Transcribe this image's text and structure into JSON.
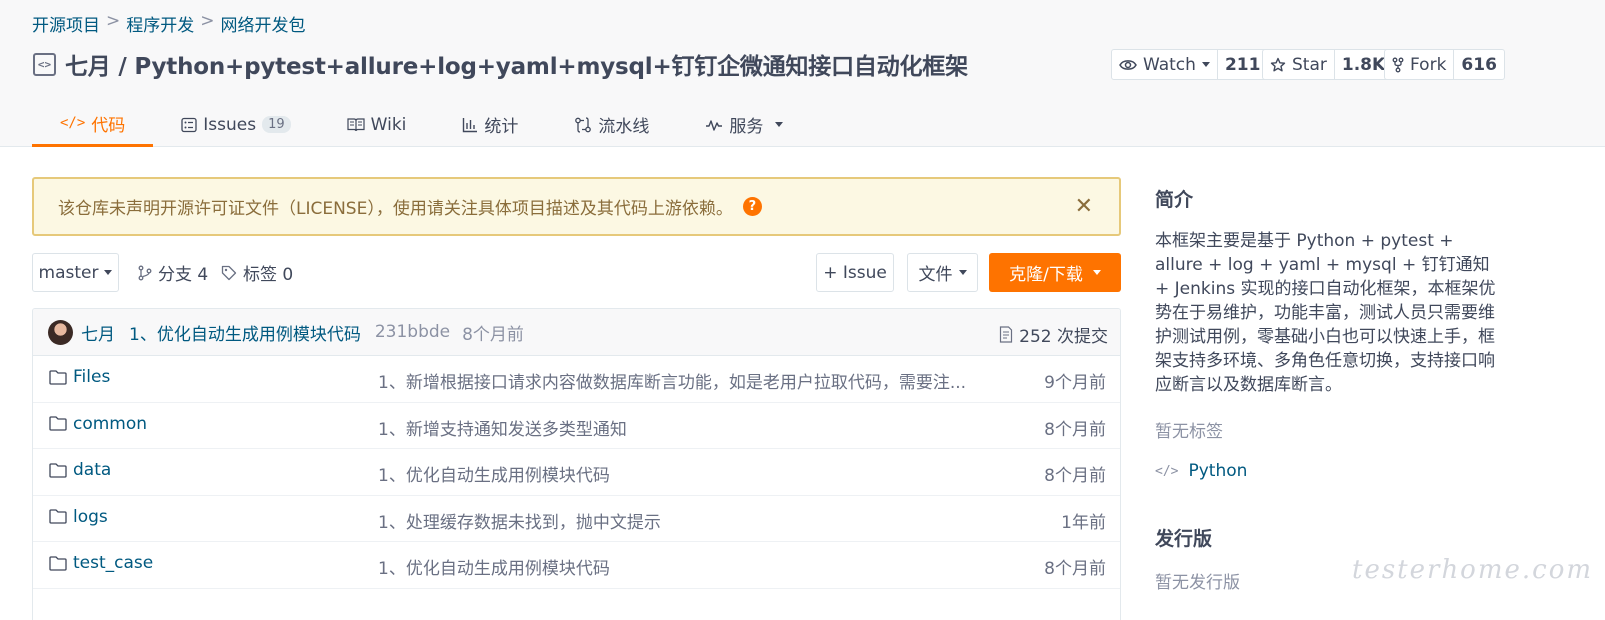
{
  "breadcrumb": {
    "items": [
      "开源项目",
      "程序开发",
      "网络开发包"
    ],
    "separator": ">"
  },
  "repo": {
    "title": "七月 / Python+pytest+allure+log+yaml+mysql+钉钉企微通知接口自动化框架"
  },
  "social": {
    "watch": {
      "label": "Watch",
      "count": "211"
    },
    "star": {
      "label": "Star",
      "count": "1.8K"
    },
    "fork": {
      "label": "Fork",
      "count": "616"
    }
  },
  "tabs": [
    {
      "label": "代码",
      "icon": "code-icon",
      "active": true
    },
    {
      "label": "Issues",
      "badge": "19",
      "icon": "issues-icon"
    },
    {
      "label": "Wiki",
      "icon": "book-icon"
    },
    {
      "label": "统计",
      "icon": "bar-chart-icon"
    },
    {
      "label": "流水线",
      "icon": "pipeline-icon"
    },
    {
      "label": "服务",
      "icon": "pulse-icon",
      "dropdown": true
    }
  ],
  "notice": {
    "text": "该仓库未声明开源许可证文件（LICENSE），使用请关注具体项目描述及其代码上游依赖。",
    "help_icon": "?",
    "close_icon": "✕"
  },
  "toolbar": {
    "branch": "master",
    "branches": "分支 4",
    "tags": "标签 0",
    "issue_button": "+ Issue",
    "file_button": "文件",
    "clone_button": "克隆/下载"
  },
  "commit": {
    "author": "七月",
    "message": "1、优化自动生成用例模块代码",
    "sha": "231bbde",
    "time": "8个月前",
    "count": "252 次提交"
  },
  "files": [
    {
      "name": "Files",
      "message": "1、新增根据接口请求内容做数据库断言功能，如是老用户拉取代码，需要注...",
      "time": "9个月前"
    },
    {
      "name": "common",
      "message": "1、新增支持通知发送多类型通知",
      "time": "8个月前"
    },
    {
      "name": "data",
      "message": "1、优化自动生成用例模块代码",
      "time": "8个月前"
    },
    {
      "name": "logs",
      "message": "1、处理缓存数据未找到，抛中文提示",
      "time": "1年前"
    },
    {
      "name": "test_case",
      "message": "1、优化自动生成用例模块代码",
      "time": "8个月前"
    }
  ],
  "sidebar": {
    "intro_title": "简介",
    "description": "本框架主要是基于 Python + pytest + allure + log + yaml + mysql + 钉钉通知 + Jenkins 实现的接口自动化框架，本框架优势在于易维护，功能丰富，测试人员只需要维护测试用例，零基础小白也可以快速上手，框架支持多环境、多角色任意切换，支持接口响应断言以及数据库断言。",
    "no_tags": "暂无标签",
    "language": "Python",
    "release_title": "发行版",
    "no_release": "暂无发行版"
  },
  "watermark": "testerhome.com",
  "colors": {
    "accent": "#fe7300",
    "link": "#005980",
    "notice_bg": "#fcf8e3",
    "notice_border": "#e6c97a"
  }
}
